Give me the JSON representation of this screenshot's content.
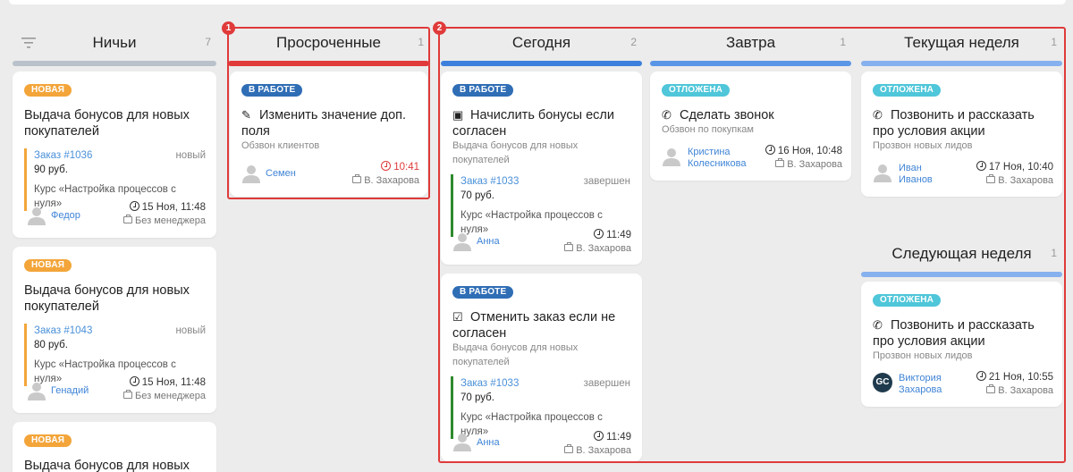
{
  "colors": {
    "bar_gray": "#b9c1cb",
    "bar_red": "#e03a3a",
    "bar_blue_dark": "#3d7fdc",
    "bar_blue": "#5a96e6",
    "bar_blue_light": "#86b1ee",
    "highlight": "#e03a3a"
  },
  "markers": {
    "one": "1",
    "two": "2"
  },
  "columns": {
    "draws": {
      "title": "Ничьи",
      "count": "7"
    },
    "overdue": {
      "title": "Просроченные",
      "count": "1"
    },
    "today": {
      "title": "Сегодня",
      "count": "2"
    },
    "tomorrow": {
      "title": "Завтра",
      "count": "1"
    },
    "this_week": {
      "title": "Текущая неделя",
      "count": "1"
    },
    "next_week": {
      "title": "Следующая неделя",
      "count": "1"
    }
  },
  "cards": {
    "d1": {
      "badge": "НОВАЯ",
      "title": "Выдача бонусов для новых покупателей",
      "order": "Заказ #1036",
      "status": "новый",
      "price": "90 руб.",
      "course": "Курс «Настройка процессов с нуля»",
      "user": "Федор",
      "date": "15 Ноя, 11:48",
      "manager": "Без менеджера"
    },
    "d2": {
      "badge": "НОВАЯ",
      "title": "Выдача бонусов для новых покупателей",
      "order": "Заказ #1043",
      "status": "новый",
      "price": "80 руб.",
      "course": "Курс «Настройка процессов с нуля»",
      "user": "Генадий",
      "date": "15 Ноя, 11:48",
      "manager": "Без менеджера"
    },
    "d3": {
      "badge": "НОВАЯ",
      "title": "Выдача бонусов для новых"
    },
    "o1": {
      "badge": "В РАБОТЕ",
      "title": "Изменить значение доп. поля",
      "subtitle": "Обзвон клиентов",
      "user": "Семен",
      "time": "10:41",
      "manager": "В. Захарова"
    },
    "t1": {
      "badge": "В РАБОТЕ",
      "title": "Начислить бонусы если согласен",
      "subtitle": "Выдача бонусов для новых покупателей",
      "order": "Заказ #1033",
      "status": "завершен",
      "price": "70 руб.",
      "course": "Курс «Настройка процессов с нуля»",
      "user": "Анна",
      "time": "11:49",
      "manager": "В. Захарова"
    },
    "t2": {
      "badge": "В РАБОТЕ",
      "title": "Отменить заказ если не согласен",
      "subtitle": "Выдача бонусов для новых покупателей",
      "order": "Заказ #1033",
      "status": "завершен",
      "price": "70 руб.",
      "course": "Курс «Настройка процессов с нуля»",
      "user": "Анна",
      "time": "11:49",
      "manager": "В. Захарова"
    },
    "tm1": {
      "badge": "ОТЛОЖЕНА",
      "title": "Сделать звонок",
      "subtitle": "Обзвон по покупкам",
      "user_line1": "Кристина",
      "user_line2": "Колесникова",
      "date": "16 Ноя, 10:48",
      "manager": "В. Захарова"
    },
    "w1": {
      "badge": "ОТЛОЖЕНА",
      "title": "Позвонить и рассказать про условия акции",
      "subtitle": "Прозвон новых лидов",
      "user_line1": "Иван",
      "user_line2": "Иванов",
      "date": "17 Ноя, 10:40",
      "manager": "В. Захарова"
    },
    "n1": {
      "badge": "ОТЛОЖЕНА",
      "title": "Позвонить и рассказать про условия акции",
      "subtitle": "Прозвон новых лидов",
      "avatar": "GC",
      "user_line1": "Виктория",
      "user_line2": "Захарова",
      "date": "21 Ноя, 10:55",
      "manager": "В. Захарова"
    }
  }
}
